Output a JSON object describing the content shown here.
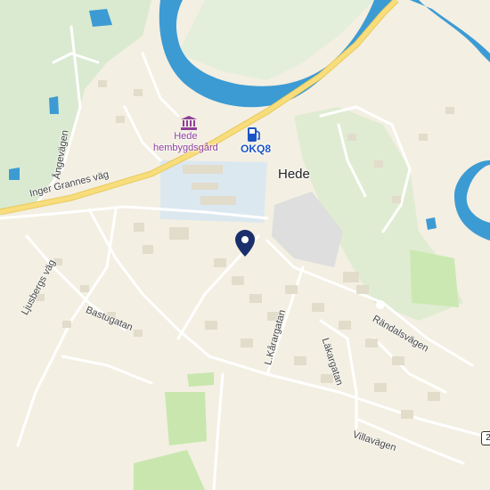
{
  "map": {
    "town": "Hede",
    "pois": {
      "museum": "Hede\nhembygdsgård",
      "fuel": "OKQ8"
    },
    "streets": {
      "ingerGrannes": "Inger Grannes väg",
      "angevagen": "Ångevägen",
      "ljusbergs": "Ljusbergs väg",
      "bastugatan": "Bastugatan",
      "lkaragatan": "L.Kårargatan",
      "lakargatan": "Läkargatan",
      "randalsvagen": "Rändalsvägen",
      "villavagen": "Villavägen"
    },
    "road_shield": "2",
    "colors": {
      "land": "#f3efe2",
      "water": "#3d9bd3",
      "forest": "#d8e9c9",
      "major_road": "#f4d470",
      "pin": "#1a2f6b"
    }
  }
}
